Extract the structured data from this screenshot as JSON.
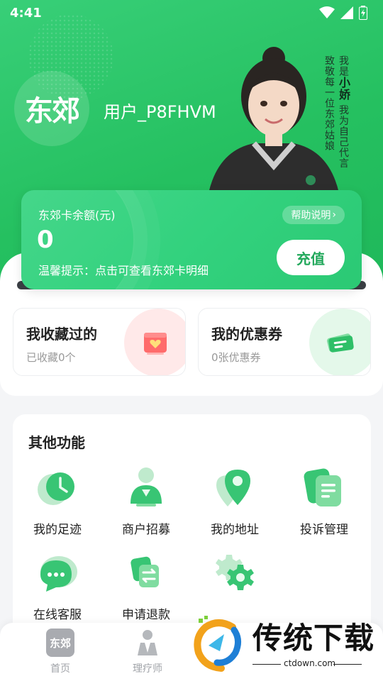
{
  "status_bar": {
    "time": "4:41"
  },
  "header": {
    "logo_text": "东郊",
    "username": "用户_P8FHVM",
    "slogan_right_1": "我是",
    "slogan_right_name": "小娇",
    "slogan_right_2": "我为自己代言",
    "slogan_left": "致敬每一位东郊姑娘"
  },
  "balance_card": {
    "label": "东郊卡余额(元)",
    "value": "0",
    "help_label": "帮助说明",
    "tip": "温馨提示：点击可查看东郊卡明细",
    "recharge_label": "充值"
  },
  "quick_cards": [
    {
      "title": "我收藏过的",
      "subtitle": "已收藏0个",
      "icon": "favorites-icon"
    },
    {
      "title": "我的优惠券",
      "subtitle": "0张优惠券",
      "icon": "coupon-icon"
    }
  ],
  "functions": {
    "title": "其他功能",
    "items": [
      {
        "label": "我的足迹",
        "icon": "clock-icon"
      },
      {
        "label": "商户招募",
        "icon": "recruit-icon"
      },
      {
        "label": "我的地址",
        "icon": "location-icon"
      },
      {
        "label": "投诉管理",
        "icon": "complaint-icon"
      },
      {
        "label": "在线客服",
        "icon": "chat-icon"
      },
      {
        "label": "申请退款",
        "icon": "refund-icon"
      },
      {
        "label": "",
        "icon": "settings-icon"
      }
    ]
  },
  "bottom_nav": {
    "items": [
      {
        "label": "首页",
        "icon_text": "东郊"
      },
      {
        "label": "理疗师",
        "icon": "therapist-icon"
      }
    ]
  },
  "watermark": {
    "brand": "传统下载",
    "url": "ctdown.com"
  },
  "colors": {
    "primary": "#25c060",
    "accent_light": "#e4f8ea",
    "favorite_bg": "#ffe9e9"
  }
}
